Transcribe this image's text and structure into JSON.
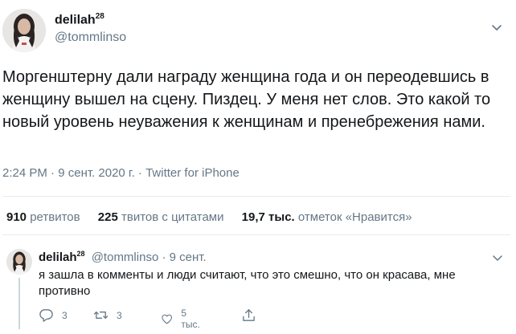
{
  "colors": {
    "text_primary": "#14171a",
    "text_secondary": "#657786",
    "divider": "#e6ecf0",
    "thread_line": "#ccd6dd"
  },
  "tweet": {
    "author_name": "delilah",
    "author_badge": "28",
    "author_handle": "@tommlinso",
    "text": "Моргенштерну дали награду женщина года и он переодевшись в женщину вышел на сцену. Пиздец. У меня нет слов. Это какой то новый уровень неуважения к женщинам и пренебрежения нами.",
    "time": "2:24 PM",
    "date": "9 сент. 2020 г.",
    "source": "Twitter for iPhone",
    "stats": {
      "retweets_count": "910",
      "retweets_label": "ретвитов",
      "quotes_count": "225",
      "quotes_label": "твитов с цитатами",
      "likes_count": "19,7 тыс.",
      "likes_label": "отметок «Нравится»"
    }
  },
  "reply": {
    "author_name": "delilah",
    "author_badge": "28",
    "author_handle": "@tommlinso",
    "time": "9 сент.",
    "text": "я зашла в комменты и люди считают, что это смешно, что он красава, мне противно",
    "actions": {
      "replies": "3",
      "retweets": "3",
      "likes": "5 тыс."
    }
  },
  "icons": {
    "menu": "chevron-down-icon",
    "reply": "speech-bubble-icon",
    "retweet": "retweet-arrows-icon",
    "like": "heart-icon",
    "share": "share-upload-icon"
  }
}
